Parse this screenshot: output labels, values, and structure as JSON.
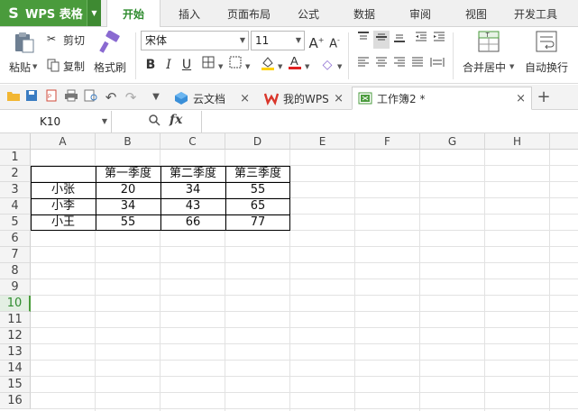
{
  "app": {
    "logo": "S",
    "name": "WPS 表格"
  },
  "tabs": [
    "开始",
    "插入",
    "页面布局",
    "公式",
    "数据",
    "审阅",
    "视图",
    "开发工具"
  ],
  "ribbon": {
    "paste": "粘贴",
    "cut": "剪切",
    "copy": "复制",
    "format_painter": "格式刷",
    "font_name": "宋体",
    "font_size": "11",
    "merge_center": "合并居中",
    "wrap_text": "自动换行"
  },
  "doc_tabs": [
    {
      "label": "云文档",
      "icon": "cloud-doc-icon"
    },
    {
      "label": "我的WPS",
      "icon": "wps-logo-icon"
    },
    {
      "label": "工作簿2 *",
      "icon": "workbook-icon"
    }
  ],
  "formula_bar": {
    "cell_ref": "K10",
    "fx": "fx",
    "content": ""
  },
  "grid": {
    "columns": [
      "A",
      "B",
      "C",
      "D",
      "E",
      "F",
      "G",
      "H"
    ],
    "rows": [
      "1",
      "2",
      "3",
      "4",
      "5",
      "6",
      "7",
      "8",
      "9",
      "10",
      "11",
      "12",
      "13",
      "14",
      "15",
      "16"
    ],
    "active_row": "10",
    "table": {
      "header": [
        "",
        "第一季度",
        "第二季度",
        "第三季度"
      ],
      "rows": [
        [
          "小张",
          "20",
          "34",
          "55"
        ],
        [
          "小李",
          "34",
          "43",
          "65"
        ],
        [
          "小王",
          "55",
          "66",
          "77"
        ]
      ]
    }
  },
  "colors": {
    "brand_green": "#4a9b3c",
    "active_tab_text": "#2e8b2e"
  }
}
